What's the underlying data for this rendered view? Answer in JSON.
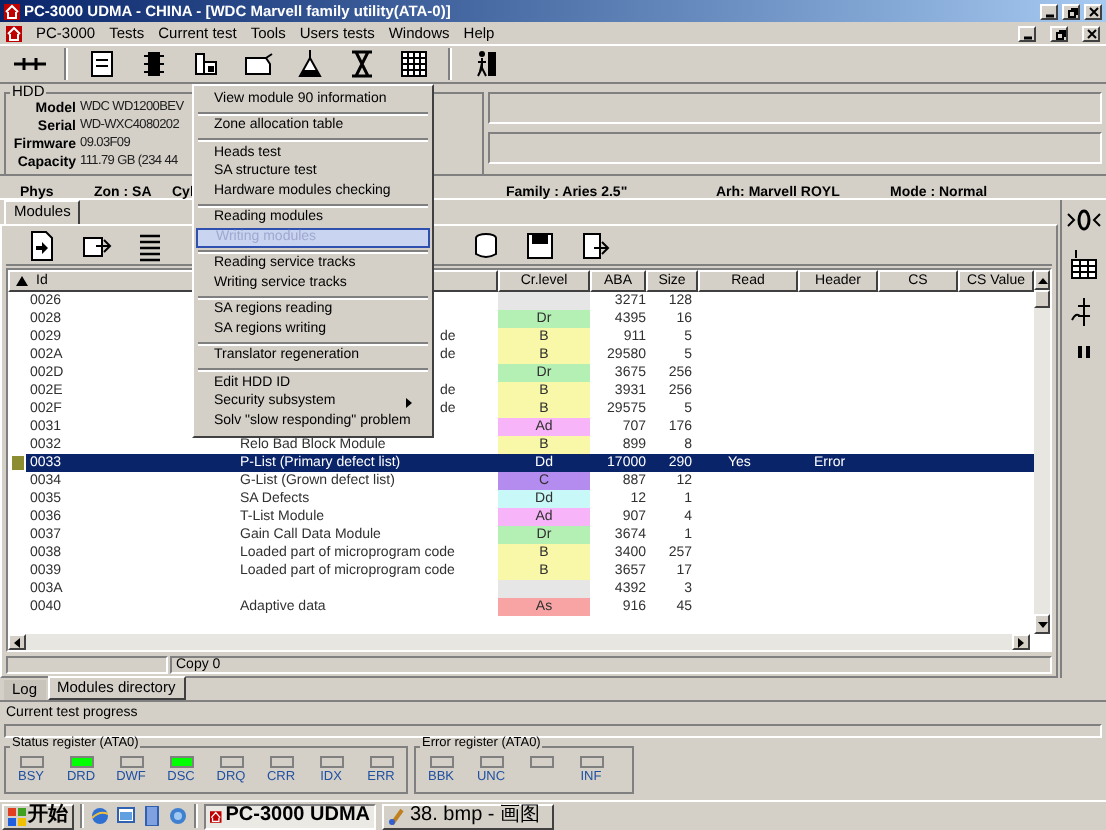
{
  "window": {
    "title": "PC-3000 UDMA - CHINA - [WDC Marvell family utility(ATA-0)]"
  },
  "menu_bar": [
    "PC-3000",
    "Tests",
    "Current test",
    "Tools",
    "Users tests",
    "Windows",
    "Help"
  ],
  "hdd": {
    "legend": "HDD",
    "fields": [
      {
        "label": "Model",
        "value": "WDC WD1200BEV"
      },
      {
        "label": "Serial",
        "value": "WD-WXC4080202"
      },
      {
        "label": "Firmware",
        "value": "09.03F09"
      },
      {
        "label": "Capacity",
        "value": "111.79 GB (234 44"
      }
    ]
  },
  "info_row": [
    "Phys",
    "Zon : SA",
    "Cyl",
    "Family : Aries 2.5\"",
    "Arh: Marvell ROYL",
    "Mode : Normal"
  ],
  "modules_tab": {
    "label": "Modules",
    "selected": true
  },
  "table": {
    "columns": [
      "Id",
      "Cr.level",
      "ABA",
      "Size",
      "Read",
      "Header",
      "CS",
      "CS Value"
    ],
    "rows": [
      {
        "id": "0026",
        "color": "#e6e6e6",
        "aba": "3271",
        "size": "128",
        "selected": false
      },
      {
        "id": "0028",
        "level": "Dr",
        "color": "#b4f0b4",
        "aba": "4395",
        "size": "16",
        "selected": false
      },
      {
        "id": "0029",
        "name": "de",
        "covered": true,
        "level": "B",
        "color": "#f8f8a8",
        "aba": "911",
        "size": "5",
        "selected": false
      },
      {
        "id": "002A",
        "name": "de",
        "covered": true,
        "level": "B",
        "color": "#f8f8a8",
        "aba": "29580",
        "size": "5",
        "selected": false
      },
      {
        "id": "002D",
        "level": "Dr",
        "color": "#b4f0b4",
        "aba": "3675",
        "size": "256",
        "selected": false
      },
      {
        "id": "002E",
        "name": "de",
        "covered": true,
        "level": "B",
        "color": "#f8f8a8",
        "aba": "3931",
        "size": "256",
        "selected": false
      },
      {
        "id": "002F",
        "name": "de",
        "covered": true,
        "level": "B",
        "color": "#f8f8a8",
        "aba": "29575",
        "size": "5",
        "selected": false
      },
      {
        "id": "0031",
        "level": "Ad",
        "color": "#f8b4f8",
        "aba": "707",
        "size": "176",
        "selected": false
      },
      {
        "id": "0032",
        "name": "Relo Bad Block Module",
        "level": "B",
        "color": "#f8f8a8",
        "aba": "899",
        "size": "8",
        "selected": false
      },
      {
        "id": "0033",
        "name": "P-List (Primary defect list)",
        "level": "Dd",
        "aba": "17000",
        "size": "290",
        "read": "Yes",
        "header": "Error",
        "selected": true
      },
      {
        "id": "0034",
        "name": "G-List (Grown defect list)",
        "level": "C",
        "color": "#b48cf0",
        "aba": "887",
        "size": "12",
        "selected": false
      },
      {
        "id": "0035",
        "name": "SA Defects",
        "level": "Dd",
        "color": "#c8f8f8",
        "aba": "12",
        "size": "1",
        "selected": false
      },
      {
        "id": "0036",
        "name": "T-List Module",
        "level": "Ad",
        "color": "#f8b4f8",
        "aba": "907",
        "size": "4",
        "selected": false
      },
      {
        "id": "0037",
        "name": "Gain Call Data Module",
        "level": "Dr",
        "color": "#b4f0b4",
        "aba": "3674",
        "size": "1",
        "selected": false
      },
      {
        "id": "0038",
        "name": "Loaded part of microprogram code",
        "level": "B",
        "color": "#f8f8a8",
        "aba": "3400",
        "size": "257",
        "selected": false
      },
      {
        "id": "0039",
        "name": "Loaded part of microprogram code",
        "level": "B",
        "color": "#f8f8a8",
        "aba": "3657",
        "size": "17",
        "selected": false
      },
      {
        "id": "003A",
        "color": "#e6e6e6",
        "aba": "4392",
        "size": "3",
        "selected": false
      },
      {
        "id": "0040",
        "name": "Adaptive data",
        "level": "As",
        "color": "#f8a4a4",
        "aba": "916",
        "size": "45",
        "selected": false
      }
    ]
  },
  "status_bar": {
    "text": "Copy 0"
  },
  "bottom_tabs": [
    {
      "label": "Log",
      "selected": false
    },
    {
      "label": "Modules directory",
      "selected": true
    }
  ],
  "progress": {
    "label": "Current test progress",
    "level": 0
  },
  "status_register": {
    "title": "Status register (ATA0)",
    "flags": [
      {
        "label": "BSY",
        "on": false
      },
      {
        "label": "DRD",
        "on": true
      },
      {
        "label": "DWF",
        "on": false
      },
      {
        "label": "DSC",
        "on": true
      },
      {
        "label": "DRQ",
        "on": false
      },
      {
        "label": "CRR",
        "on": false
      },
      {
        "label": "IDX",
        "on": false
      },
      {
        "label": "ERR",
        "on": false
      }
    ]
  },
  "error_register": {
    "title": "Error register (ATA0)",
    "flags": [
      {
        "label": "BBK",
        "on": false
      },
      {
        "label": "UNC",
        "on": false
      },
      {
        "on": false
      },
      {
        "label": "INF",
        "on": false
      }
    ]
  },
  "context_menu": {
    "items": [
      {
        "kind": "item",
        "label": "View module 90 information",
        "selected": false
      },
      {
        "kind": "separator"
      },
      {
        "kind": "item",
        "label": "Zone allocation table",
        "selected": false
      },
      {
        "kind": "separator"
      },
      {
        "kind": "item",
        "label": "Heads test",
        "selected": false
      },
      {
        "kind": "item",
        "label": "SA structure test",
        "selected": false
      },
      {
        "kind": "item",
        "label": "Hardware modules checking",
        "selected": false
      },
      {
        "kind": "separator"
      },
      {
        "kind": "item",
        "label": "Reading modules",
        "selected": false
      },
      {
        "kind": "item",
        "label": "Writing modules",
        "selected": true
      },
      {
        "kind": "separator"
      },
      {
        "kind": "item",
        "label": "Reading service tracks",
        "selected": false
      },
      {
        "kind": "item",
        "label": "Writing service tracks",
        "selected": false
      },
      {
        "kind": "separator"
      },
      {
        "kind": "item",
        "label": "SA regions reading",
        "selected": false
      },
      {
        "kind": "item",
        "label": "SA regions writing",
        "selected": false
      },
      {
        "kind": "separator"
      },
      {
        "kind": "item",
        "label": "Translator regeneration",
        "selected": false
      },
      {
        "kind": "separator"
      },
      {
        "kind": "item",
        "label": "Edit HDD ID",
        "selected": false
      },
      {
        "kind": "submenu",
        "label": "Security subsystem",
        "selected": false
      },
      {
        "kind": "item",
        "label": "Solv \"slow responding\" problem",
        "selected": false
      }
    ]
  },
  "taskbar": {
    "start": "开始",
    "tasks": [
      {
        "label": "PC-3000 UDMA",
        "selected": true
      },
      {
        "label": "38. bmp - 画图",
        "selected": false
      }
    ]
  }
}
